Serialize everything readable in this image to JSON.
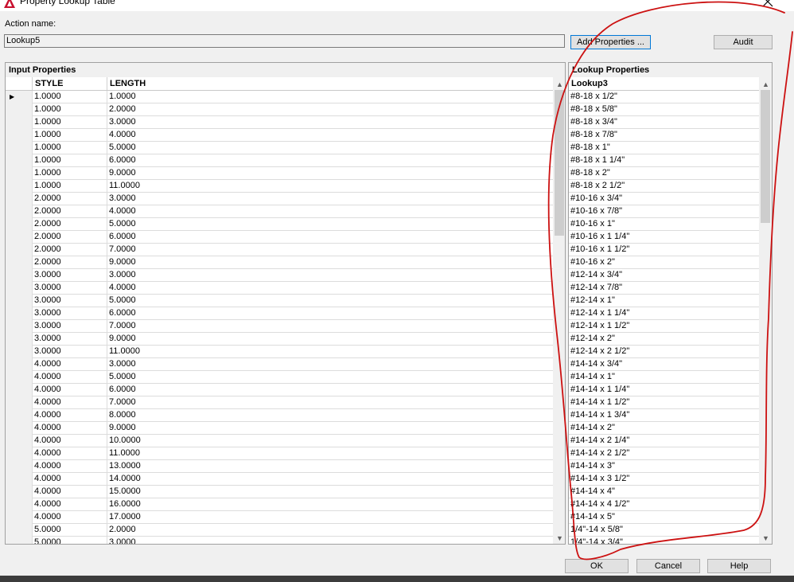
{
  "window": {
    "title": "Property Lookup Table"
  },
  "action": {
    "label": "Action name:",
    "value": "Lookup5"
  },
  "buttons": {
    "add_properties": "Add Properties ...",
    "audit": "Audit",
    "ok": "OK",
    "cancel": "Cancel",
    "help": "Help"
  },
  "input_panel": {
    "title": "Input Properties",
    "columns": [
      "STYLE",
      "LENGTH"
    ],
    "rows": [
      [
        "1.0000",
        "1.0000"
      ],
      [
        "1.0000",
        "2.0000"
      ],
      [
        "1.0000",
        "3.0000"
      ],
      [
        "1.0000",
        "4.0000"
      ],
      [
        "1.0000",
        "5.0000"
      ],
      [
        "1.0000",
        "6.0000"
      ],
      [
        "1.0000",
        "9.0000"
      ],
      [
        "1.0000",
        "11.0000"
      ],
      [
        "2.0000",
        "3.0000"
      ],
      [
        "2.0000",
        "4.0000"
      ],
      [
        "2.0000",
        "5.0000"
      ],
      [
        "2.0000",
        "6.0000"
      ],
      [
        "2.0000",
        "7.0000"
      ],
      [
        "2.0000",
        "9.0000"
      ],
      [
        "3.0000",
        "3.0000"
      ],
      [
        "3.0000",
        "4.0000"
      ],
      [
        "3.0000",
        "5.0000"
      ],
      [
        "3.0000",
        "6.0000"
      ],
      [
        "3.0000",
        "7.0000"
      ],
      [
        "3.0000",
        "9.0000"
      ],
      [
        "3.0000",
        "11.0000"
      ],
      [
        "4.0000",
        "3.0000"
      ],
      [
        "4.0000",
        "5.0000"
      ],
      [
        "4.0000",
        "6.0000"
      ],
      [
        "4.0000",
        "7.0000"
      ],
      [
        "4.0000",
        "8.0000"
      ],
      [
        "4.0000",
        "9.0000"
      ],
      [
        "4.0000",
        "10.0000"
      ],
      [
        "4.0000",
        "11.0000"
      ],
      [
        "4.0000",
        "13.0000"
      ],
      [
        "4.0000",
        "14.0000"
      ],
      [
        "4.0000",
        "15.0000"
      ],
      [
        "4.0000",
        "16.0000"
      ],
      [
        "4.0000",
        "17.0000"
      ],
      [
        "5.0000",
        "2.0000"
      ],
      [
        "5.0000",
        "3.0000"
      ]
    ]
  },
  "lookup_panel": {
    "title": "Lookup Properties",
    "column": "Lookup3",
    "rows": [
      "#8-18 x 1/2\"",
      "#8-18 x 5/8\"",
      "#8-18 x 3/4\"",
      "#8-18 x 7/8\"",
      "#8-18 x 1\"",
      "#8-18 x 1 1/4\"",
      "#8-18 x 2\"",
      "#8-18 x 2 1/2\"",
      "#10-16 x 3/4\"",
      "#10-16 x 7/8\"",
      "#10-16 x 1\"",
      "#10-16 x 1 1/4\"",
      "#10-16 x 1 1/2\"",
      "#10-16 x 2\"",
      "#12-14 x 3/4\"",
      "#12-14 x 7/8\"",
      "#12-14 x 1\"",
      "#12-14 x 1 1/4\"",
      "#12-14 x 1 1/2\"",
      "#12-14 x 2\"",
      "#12-14 x 2 1/2\"",
      "#14-14 x 3/4\"",
      "#14-14 x 1\"",
      "#14-14 x 1 1/4\"",
      "#14-14 x 1 1/2\"",
      "#14-14 x 1 3/4\"",
      "#14-14 x 2\"",
      "#14-14 x 2 1/4\"",
      "#14-14 x 2 1/2\"",
      "#14-14 x 3\"",
      "#14-14 x 3 1/2\"",
      "#14-14 x 4\"",
      "#14-14 x 4 1/2\"",
      "#14-14 x 5\"",
      "1/4\"-14 x 5/8\"",
      "1/4\"-14 x 3/4\""
    ]
  },
  "icons": {
    "app": "autocad-logo-icon",
    "close": "close-icon",
    "row_pointer": "row-pointer-icon",
    "scroll_up": "scroll-up-arrow-icon",
    "scroll_down": "scroll-down-arrow-icon"
  },
  "colors": {
    "annotation": "#cc1111",
    "focus_border": "#0078d7"
  }
}
